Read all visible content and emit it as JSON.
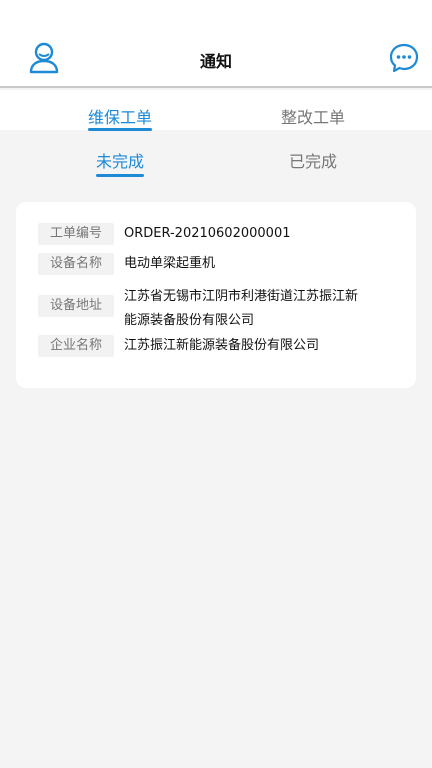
{
  "header": {
    "title": "通知",
    "left_icon": "user-icon",
    "right_icon": "chat-bubble-icon",
    "accent_color": "#1e8ad6"
  },
  "top_tabs": [
    {
      "label": "维保工单",
      "active": true
    },
    {
      "label": "整改工单",
      "active": false
    }
  ],
  "sub_tabs": [
    {
      "label": "未完成",
      "active": true
    },
    {
      "label": "已完成",
      "active": false
    }
  ],
  "order_card": {
    "order_no_label": "工单编号",
    "order_no": "ORDER-20210602000001",
    "device_name_label": "设备名称",
    "device_name": "电动单梁起重机",
    "device_address_label": "设备地址",
    "device_address": "江苏省无锡市江阴市利港街道江苏振江新能源装备股份有限公司",
    "company_label": "企业名称",
    "company": "江苏振江新能源装备股份有限公司"
  }
}
